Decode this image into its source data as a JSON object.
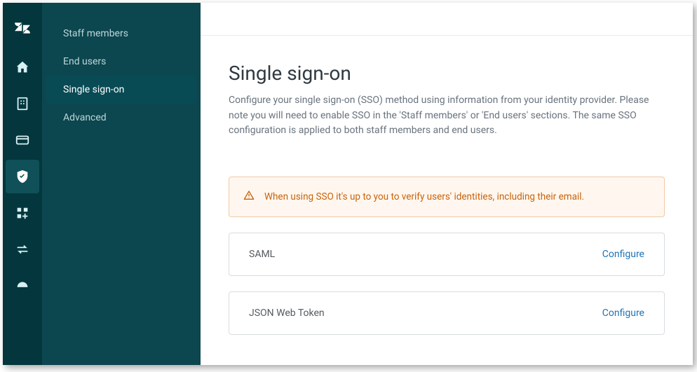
{
  "sidebar": {
    "items": [
      {
        "label": "Staff members"
      },
      {
        "label": "End users"
      },
      {
        "label": "Single sign-on"
      },
      {
        "label": "Advanced"
      }
    ]
  },
  "page": {
    "title": "Single sign-on",
    "description": "Configure your single sign-on (SSO) method using information from your identity provider. Please note you will need to enable SSO in the 'Staff members' or 'End users' sections. The same SSO configuration is applied to both staff members and end users."
  },
  "alert": {
    "message": "When using SSO it's up to you to verify users' identities, including their email."
  },
  "methods": [
    {
      "name": "SAML",
      "action": "Configure"
    },
    {
      "name": "JSON Web Token",
      "action": "Configure"
    }
  ]
}
